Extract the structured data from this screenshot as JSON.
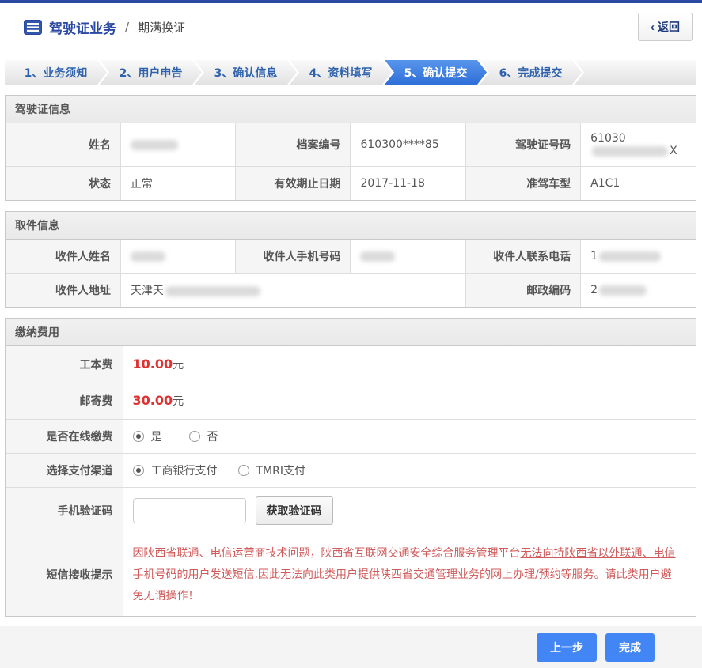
{
  "window": {
    "title_primary": "驾驶证业务",
    "title_separator": "/",
    "title_secondary": "期满换证",
    "back_chevron": "‹",
    "back_label": "返回"
  },
  "steps": [
    {
      "label": "1、业务须知",
      "active": false
    },
    {
      "label": "2、用户申告",
      "active": false
    },
    {
      "label": "3、确认信息",
      "active": false
    },
    {
      "label": "4、资料填写",
      "active": false
    },
    {
      "label": "5、确认提交",
      "active": true
    },
    {
      "label": "6、完成提交",
      "active": false
    }
  ],
  "active_step_index": 4,
  "sections": {
    "license": {
      "title": "驾驶证信息",
      "fields": {
        "name": {
          "label": "姓名",
          "value_redacted": true
        },
        "file_number": {
          "label": "档案编号",
          "value": "610300****85"
        },
        "license_number": {
          "label": "驾驶证号码",
          "value_prefix": "61030",
          "value_suffix": "X",
          "middle_redacted": true
        },
        "status": {
          "label": "状态",
          "value": "正常"
        },
        "valid_until": {
          "label": "有效期止日期",
          "value": "2017-11-18"
        },
        "vehicle_class": {
          "label": "准驾车型",
          "value": "A1C1"
        }
      }
    },
    "pickup": {
      "title": "取件信息",
      "fields": {
        "recipient_name": {
          "label": "收件人姓名",
          "value_redacted": true
        },
        "recipient_mobile": {
          "label": "收件人手机号码",
          "value_redacted": true
        },
        "recipient_phone": {
          "label": "收件人联系电话",
          "value_prefix": "1",
          "suffix_redacted": true
        },
        "recipient_address": {
          "label": "收件人地址",
          "value_prefix": "天津天",
          "suffix_redacted": true
        },
        "postal_code": {
          "label": "邮政编码",
          "value_prefix": "2",
          "suffix_redacted": true
        }
      }
    },
    "fees": {
      "title": "缴纳费用",
      "production_fee": {
        "label": "工本费",
        "amount": "10.00",
        "unit": "元"
      },
      "postage_fee": {
        "label": "邮寄费",
        "amount": "30.00",
        "unit": "元"
      },
      "online_payment": {
        "label": "是否在线缴费",
        "options": [
          {
            "label": "是",
            "selected": true
          },
          {
            "label": "否",
            "selected": false
          }
        ]
      },
      "payment_channel": {
        "label": "选择支付渠道",
        "options": [
          {
            "label": "工商银行支付",
            "selected": true
          },
          {
            "label": "TMRI支付",
            "selected": false
          }
        ]
      },
      "sms_code": {
        "label": "手机验证码",
        "input_value": "",
        "button_label": "获取验证码"
      },
      "sms_notice": {
        "label": "短信接收提示",
        "text_part1": "因陕西省联通、电信运营商技术问题，陕西省互联网交通安全综合服务管理平台",
        "text_part2_underlined": "无法向持陕西省以外联通、电信手机号码的用户发送短信,因此无法向此类用户提供陕西省交通管理业务的网上办理/预约等服务。",
        "text_part3": "请此类用户避免无谓操作！"
      }
    }
  },
  "footer": {
    "previous_label": "上一步",
    "finish_label": "完成"
  },
  "colors": {
    "top_bar": "#2b49a3",
    "accent_blue": "#4285f4",
    "active_step_blue": "#2e6fd8",
    "step_text_blue": "#2f62ae",
    "fee_red": "#e03131",
    "notice_red": "#d05a5a"
  }
}
